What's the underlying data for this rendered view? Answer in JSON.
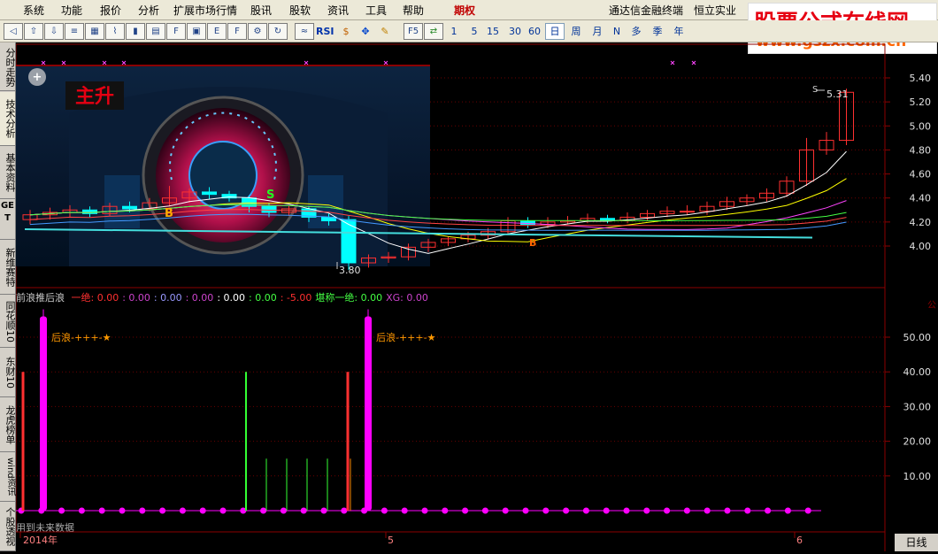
{
  "menu": {
    "items": [
      "系统",
      "功能",
      "报价",
      "分析",
      "扩展市场行情",
      "股讯",
      "股软",
      "资讯",
      "工具",
      "帮助"
    ],
    "active": "期权",
    "title": "通达信金融终端",
    "stock": "恒立实业"
  },
  "watermark": {
    "line1": "股票公式在线网",
    "line2": "www.gszx.com.cn"
  },
  "toolbar": {
    "periods": [
      "1",
      "5",
      "15",
      "30",
      "60",
      "日",
      "周",
      "月",
      "N",
      "多",
      "季",
      "年"
    ],
    "selected_period": "日",
    "rsi_label": "RSI",
    "f5_label": "F5"
  },
  "sidebar": {
    "tabs": [
      "分时走势",
      "技术分析",
      "基本资料",
      "GET",
      "新维赛特",
      "同花顺10",
      "东财10",
      "龙虎榜单",
      "wind资讯",
      "个股透视"
    ]
  },
  "photo": {
    "brand": "主升"
  },
  "upper": {
    "yticks": [
      "5.40",
      "5.20",
      "5.00",
      "4.80",
      "4.60",
      "4.40",
      "4.20",
      "4.00"
    ],
    "high_label": "5.31",
    "low_label": "3.80",
    "markers": {
      "b1": "B",
      "s1": "S",
      "b2": "B",
      "s2": "S"
    }
  },
  "indicator": {
    "name": "前浪推后浪",
    "pairs": [
      {
        "label": "一绝",
        "value": "0.00",
        "color": "#ff3030"
      },
      {
        "label": "",
        "value": "0.00",
        "color": "#cc44cc"
      },
      {
        "label": "",
        "value": "0.00",
        "color": "#9999ff"
      },
      {
        "label": "",
        "value": "0.00",
        "color": "#cc44cc"
      },
      {
        "label": "",
        "value": "0.00",
        "color": "#ffffff"
      },
      {
        "label": "",
        "value": "0.00",
        "color": "#44ff44"
      },
      {
        "label": "",
        "value": "-5.00",
        "color": "#ff3030"
      },
      {
        "label": "堪称一绝",
        "value": "0.00",
        "color": "#44ff44"
      },
      {
        "label": "XG",
        "value": "0.00",
        "color": "#cc44cc"
      }
    ],
    "wave_label": "后浪-+++-★",
    "future_note": "用到未来数据"
  },
  "lower": {
    "yticks": [
      "50.00",
      "40.00",
      "30.00",
      "20.00",
      "10.00"
    ]
  },
  "xaxis": {
    "labels": [
      "2014年",
      "5",
      "6"
    ]
  },
  "bottom_tab": "日线",
  "colors": {
    "up": "#ff3030",
    "down": "#00ffff",
    "grid": "#7a0000",
    "accent": "#ff00ff"
  }
}
